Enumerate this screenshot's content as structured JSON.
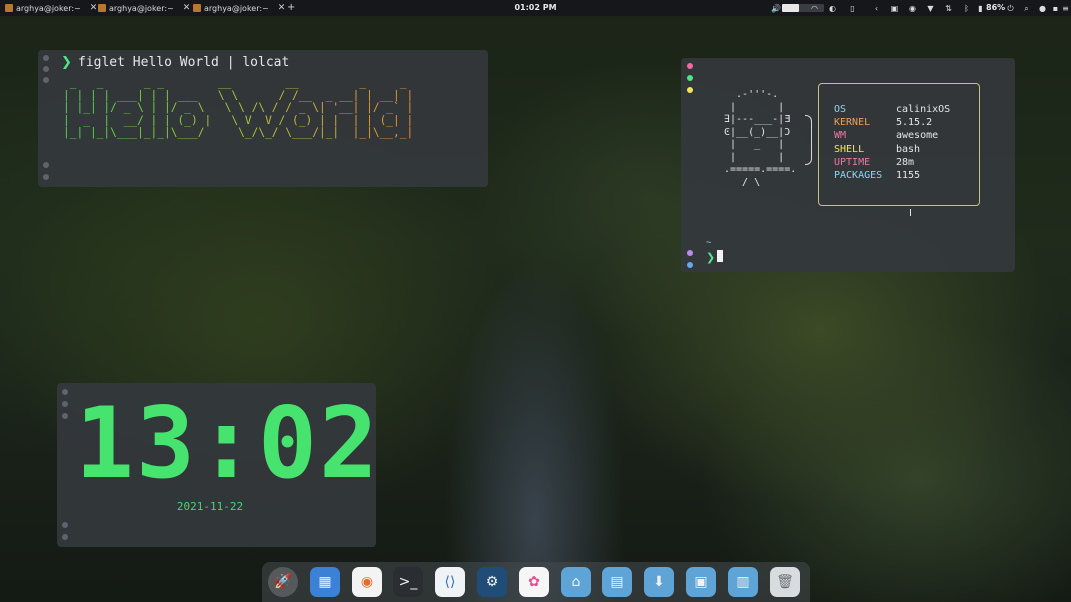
{
  "topbar": {
    "tabs": [
      {
        "title": "arghya@joker:~",
        "close": "✕"
      },
      {
        "title": "arghya@joker:~",
        "close": "✕"
      },
      {
        "title": "arghya@joker:~",
        "close": "✕"
      }
    ],
    "add_tab": "+",
    "clock": "01:02 PM",
    "battery": "86%",
    "volume_level": 0.4,
    "brightness_level": 0.5,
    "icons": [
      "volume-icon",
      "wifi-icon",
      "brightness-icon",
      "clipboard-icon",
      "back-icon",
      "screenshot-icon",
      "record-icon",
      "vpn-icon",
      "network-icon",
      "bluetooth-icon",
      "battery-icon",
      "power-icon",
      "search-icon",
      "notifications-icon",
      "layout-icon",
      "menu-icon"
    ]
  },
  "terminal_figlet": {
    "prompt": "❯",
    "command": "figlet Hello World | lolcat",
    "output": " _   _      _ _        __        __         _     _ \n| | | | ___| | | ___   \\ \\      / /__  _ __| | __| |\n| |_| |/ _ \\ | |/ _ \\   \\ \\ /\\ / / _ \\| '__| |/ _` |\n|  _  |  __/ | | (_) |   \\ V  V / (_) | |  | | (_| |\n|_| |_|\\___|_|_|\\___/     \\_/\\_/ \\___/|_|  |_|\\__,_|",
    "gradient": [
      "#57d25c",
      "#7fd13f",
      "#b6c13d",
      "#d9a83e",
      "#e6903c"
    ]
  },
  "terminal_fetch": {
    "ascii_art": "  .-'''-.\n |       |\n∃|---___-|Ǝ\nϾ|__(_)__|Ͻ\n |   _   |\n |       |\n.=====.====.\n   / \\",
    "info": [
      {
        "key": "OS",
        "value": "calinixOS",
        "color": "#8fd6f0"
      },
      {
        "key": "KERNEL",
        "value": "5.15.2",
        "color": "#e8a15b"
      },
      {
        "key": "WM",
        "value": "awesome",
        "color": "#e879a3"
      },
      {
        "key": "SHELL",
        "value": "bash",
        "color": "#f2e45c"
      },
      {
        "key": "UPTIME",
        "value": "28m",
        "color": "#e879a3"
      },
      {
        "key": "PACKAGES",
        "value": "1155",
        "color": "#8fd6f0"
      }
    ],
    "cwd": "~",
    "prompt": "❯"
  },
  "clock_widget": {
    "time": "13:02",
    "date": "2021-11-22",
    "color": "#47e36f"
  },
  "dock": {
    "items": [
      {
        "name": "launchpad-icon",
        "glyph": "🚀",
        "bg": "#55595c"
      },
      {
        "name": "archive-manager-icon",
        "glyph": "▦",
        "bg": "#3b82d6"
      },
      {
        "name": "firefox-icon",
        "glyph": "◉",
        "bg": "#f3f3f3"
      },
      {
        "name": "terminal-icon",
        "glyph": ">_",
        "bg": "#2a2d31"
      },
      {
        "name": "vscode-icon",
        "glyph": "⟨⟩",
        "bg": "#f0f3f6"
      },
      {
        "name": "steam-icon",
        "glyph": "⚙",
        "bg": "#1f4d78"
      },
      {
        "name": "photos-icon",
        "glyph": "✿",
        "bg": "#f6f6f6"
      },
      {
        "name": "home-folder-icon",
        "glyph": "⌂",
        "bg": "#5ea4d6"
      },
      {
        "name": "documents-folder-icon",
        "glyph": "▤",
        "bg": "#5ea4d6"
      },
      {
        "name": "downloads-folder-icon",
        "glyph": "⬇",
        "bg": "#5ea4d6"
      },
      {
        "name": "pictures-folder-icon",
        "glyph": "▣",
        "bg": "#5ea4d6"
      },
      {
        "name": "videos-folder-icon",
        "glyph": "▥",
        "bg": "#5ea4d6"
      },
      {
        "name": "trash-icon",
        "glyph": "🗑",
        "bg": "#d9dcdf"
      }
    ]
  }
}
